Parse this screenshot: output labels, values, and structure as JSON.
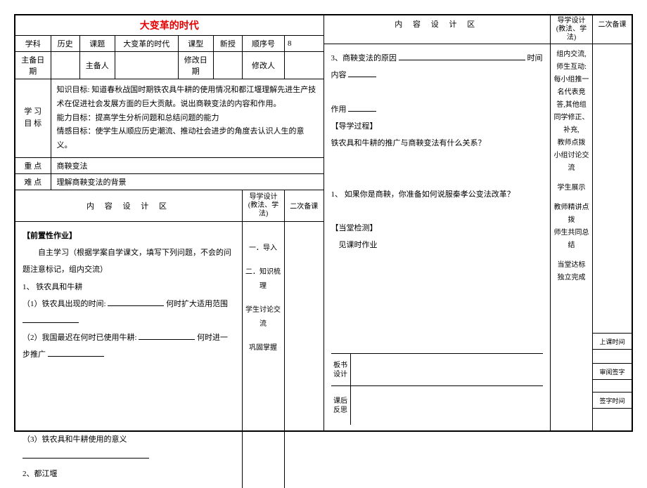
{
  "title": "大变革的时代",
  "info": {
    "subject_label": "学科",
    "subject": "历史",
    "topic_label": "课题",
    "topic": "大变革的时代",
    "type_label": "课型",
    "type": "新授",
    "seq_label": "顺序号",
    "seq": "8",
    "prep_date_label": "主备日期",
    "prep_date": "",
    "prep_person_label": "主备人",
    "prep_person": "",
    "rev_date_label": "修改日期",
    "rev_date": "",
    "rev_person_label": "修改人",
    "rev_person": ""
  },
  "objectives": {
    "label": "学 习\n目 标",
    "knowledge": "知识目标: 知道春秋战国时期铁农具牛耕的使用情况和都江堰理解先进生产技术在促进社会发展方面的巨大贡献。说出商鞅变法的内容和作用。",
    "ability": "能力目标：提高学生分析问题和总结问题的能力",
    "emotion": "情感目标：使学生从顺应历史潮流、推动社会进步的角度去认识人生的意义。"
  },
  "keypoint": {
    "label": "重 点",
    "text": "商鞅变法"
  },
  "difficulty": {
    "label": "难 点",
    "text": "理解商鞅变法的背景"
  },
  "content_header": {
    "main": "内 容 设 计 区",
    "method": "导学设计\n(教法、学法)",
    "secondary": "二次备课"
  },
  "left_content": {
    "prework_title": "【前置性作业】",
    "self_study": "自主学习（根据学案自学课文，填写下列问题，不会的问题注意标记，组内交流）",
    "item1_title": "1、 铁农具和牛耕",
    "item1_1_a": "（1）铁农具出现的时间:",
    "item1_1_b": "何时扩大适用范围",
    "item1_2_a": "（2）我国最迟在何时已使用牛耕:",
    "item1_2_b": "何时进一步推广",
    "item1_3": "（3）铁农具和牛耕使用的意义",
    "item2_title": "2、都江堰"
  },
  "left_method": {
    "m1": "一．导入",
    "m2": "二．知识梳理",
    "m3": "学生讨论交流",
    "m4": "巩固掌握"
  },
  "right_content": {
    "q3_a": "3、商鞅变法的原因",
    "q3_b": "时间",
    "q3_c": "内容",
    "q3_d": "作用",
    "guide_title": "【导学过程】",
    "guide_q": "铁农具和牛耕的推广与商鞅变法有什么关系？",
    "q_num1": "1、 如果你是商鞅，你准备如何说服秦孝公变法改革？",
    "test_title": "【当堂检测】",
    "test_body": "见课时作业"
  },
  "right_method": {
    "m1": "组内交流,\n师生互动:\n每小组推一名代表竞答,其他组同学修正、补充,\n教师点拨\n小组讨论交流",
    "m2": "学生展示",
    "m3": "教师精讲点拨\n师生共同总结",
    "m4": "当堂达标\n独立完成"
  },
  "footer": {
    "board_label": "板书\n设计",
    "reflect_label": "课后\n反思",
    "class_time": "上课时间",
    "review_sign": "审阅签字",
    "sign_time": "签字时间"
  }
}
